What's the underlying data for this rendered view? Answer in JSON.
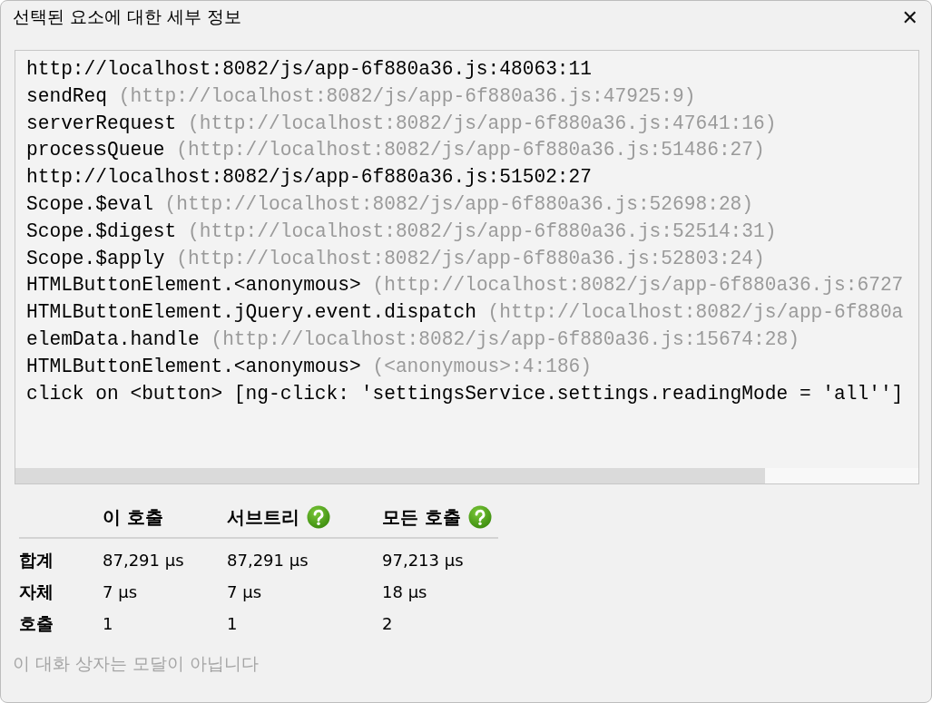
{
  "window": {
    "title": "선택된 요소에 대한 세부 정보",
    "close": "✕"
  },
  "stack_trace": [
    {
      "call": "http://localhost:8082/js/app-6f880a36.js:48063:11"
    },
    {
      "call": "sendReq",
      "location": "(http://localhost:8082/js/app-6f880a36.js:47925:9)"
    },
    {
      "call": "serverRequest",
      "location": "(http://localhost:8082/js/app-6f880a36.js:47641:16)"
    },
    {
      "call": "processQueue",
      "location": "(http://localhost:8082/js/app-6f880a36.js:51486:27)"
    },
    {
      "call": "http://localhost:8082/js/app-6f880a36.js:51502:27"
    },
    {
      "call": "Scope.$eval",
      "location": "(http://localhost:8082/js/app-6f880a36.js:52698:28)"
    },
    {
      "call": "Scope.$digest",
      "location": "(http://localhost:8082/js/app-6f880a36.js:52514:31)"
    },
    {
      "call": "Scope.$apply",
      "location": "(http://localhost:8082/js/app-6f880a36.js:52803:24)"
    },
    {
      "call": "HTMLButtonElement.<anonymous>",
      "location": "(http://localhost:8082/js/app-6f880a36.js:6727"
    },
    {
      "call": "HTMLButtonElement.jQuery.event.dispatch",
      "location": "(http://localhost:8082/js/app-6f880a"
    },
    {
      "call": "elemData.handle",
      "location": "(http://localhost:8082/js/app-6f880a36.js:15674:28)"
    },
    {
      "call": "HTMLButtonElement.<anonymous>",
      "location": "(<anonymous>:4:186)"
    },
    {
      "call": "click on <button> [ng-click: 'settingsService.settings.readingMode = 'all'']"
    }
  ],
  "stats": {
    "columns": [
      {
        "label": "이 호출",
        "help": false
      },
      {
        "label": "서브트리",
        "help": true
      },
      {
        "label": "모든 호출",
        "help": true
      }
    ],
    "rows": [
      {
        "label": "합계",
        "values": [
          "87,291 µs",
          "87,291 µs",
          "97,213 µs"
        ]
      },
      {
        "label": "자체",
        "values": [
          "7 µs",
          "7 µs",
          "18 µs"
        ]
      },
      {
        "label": "호출",
        "values": [
          "1",
          "1",
          "2"
        ]
      }
    ]
  },
  "footer": "이 대화 상자는 모달이 아닙니다"
}
